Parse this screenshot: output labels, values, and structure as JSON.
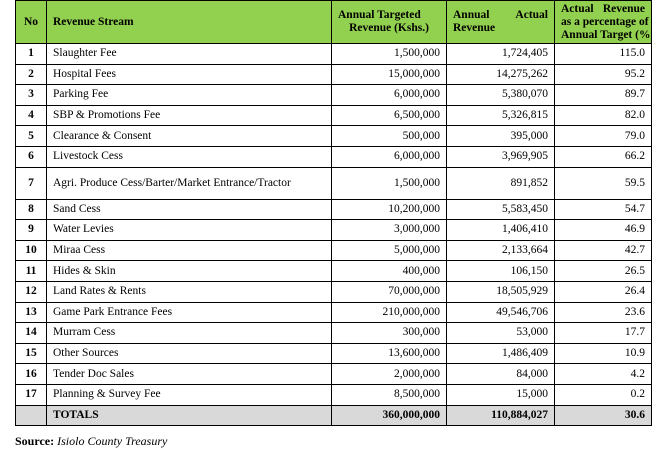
{
  "columns": {
    "no": "No",
    "stream": "Revenue Stream",
    "target_l1": "Annual Targeted",
    "target_l2": "Revenue (Kshs.)",
    "actual_l1a": "Annual",
    "actual_l1b": "Actual",
    "actual_l2": "Revenue",
    "pct_l1a": "Actual",
    "pct_l1b": "Revenue",
    "pct_l2": "as a percentage of",
    "pct_l3": "Annual Target (%)"
  },
  "rows": [
    {
      "no": "1",
      "stream": "Slaughter Fee",
      "target": "1,500,000",
      "actual": "1,724,405",
      "pct": "115.0"
    },
    {
      "no": "2",
      "stream": "Hospital Fees",
      "target": "15,000,000",
      "actual": "14,275,262",
      "pct": "95.2"
    },
    {
      "no": "3",
      "stream": "Parking Fee",
      "target": "6,000,000",
      "actual": "5,380,070",
      "pct": "89.7"
    },
    {
      "no": "4",
      "stream": "SBP & Promotions Fee",
      "target": "6,500,000",
      "actual": "5,326,815",
      "pct": "82.0"
    },
    {
      "no": "5",
      "stream": "Clearance & Consent",
      "target": "500,000",
      "actual": "395,000",
      "pct": "79.0"
    },
    {
      "no": "6",
      "stream": "Livestock Cess",
      "target": "6,000,000",
      "actual": "3,969,905",
      "pct": "66.2"
    },
    {
      "no": "7",
      "stream": "Agri. Produce Cess/Barter/Market Entrance/Tractor",
      "target": "1,500,000",
      "actual": "891,852",
      "pct": "59.5"
    },
    {
      "no": "8",
      "stream": "Sand Cess",
      "target": "10,200,000",
      "actual": "5,583,450",
      "pct": "54.7"
    },
    {
      "no": "9",
      "stream": "Water Levies",
      "target": "3,000,000",
      "actual": "1,406,410",
      "pct": "46.9"
    },
    {
      "no": "10",
      "stream": "Miraa Cess",
      "target": "5,000,000",
      "actual": "2,133,664",
      "pct": "42.7"
    },
    {
      "no": "11",
      "stream": "Hides & Skin",
      "target": "400,000",
      "actual": "106,150",
      "pct": "26.5"
    },
    {
      "no": "12",
      "stream": "Land Rates & Rents",
      "target": "70,000,000",
      "actual": "18,505,929",
      "pct": "26.4"
    },
    {
      "no": "13",
      "stream": "Game Park Entrance Fees",
      "target": "210,000,000",
      "actual": "49,546,706",
      "pct": "23.6"
    },
    {
      "no": "14",
      "stream": "Murram Cess",
      "target": "300,000",
      "actual": "53,000",
      "pct": "17.7"
    },
    {
      "no": "15",
      "stream": "Other Sources",
      "target": "13,600,000",
      "actual": "1,486,409",
      "pct": "10.9"
    },
    {
      "no": "16",
      "stream": "Tender Doc Sales",
      "target": "2,000,000",
      "actual": "84,000",
      "pct": "4.2"
    },
    {
      "no": "17",
      "stream": "Planning & Survey Fee",
      "target": "8,500,000",
      "actual": "15,000",
      "pct": "0.2"
    }
  ],
  "totals": {
    "label": "TOTALS",
    "target": "360,000,000",
    "actual": "110,884,027",
    "pct": "30.6"
  },
  "source": {
    "label": "Source:",
    "text": "Isiolo County Treasury"
  }
}
